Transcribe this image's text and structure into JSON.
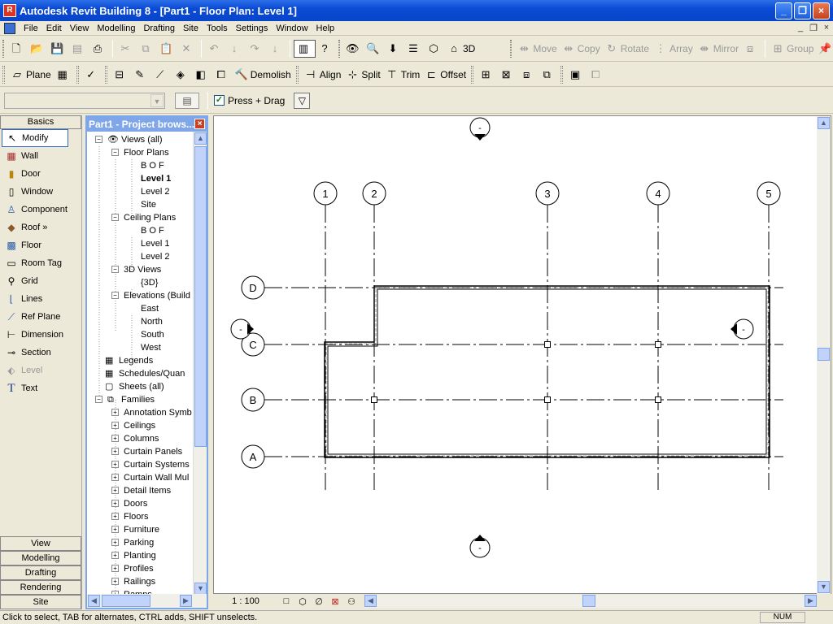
{
  "window": {
    "title": "Autodesk Revit Building 8 - [Part1 - Floor Plan: Level 1]",
    "controls": {
      "minimize": "_",
      "maximize": "❐",
      "close": "×"
    }
  },
  "menubar": {
    "items": [
      "File",
      "Edit",
      "View",
      "Modelling",
      "Drafting",
      "Site",
      "Tools",
      "Settings",
      "Window",
      "Help"
    ],
    "mdi_controls": [
      "_",
      "❐",
      "×"
    ]
  },
  "toolbar1": {
    "view_3d_label": "3D",
    "edit_tools": [
      "Move",
      "Copy",
      "Rotate",
      "Array",
      "Mirror",
      "Group"
    ]
  },
  "toolbar2": {
    "plane_label": "Plane",
    "demolish_label": "Demolish",
    "align_label": "Align",
    "split_label": "Split",
    "trim_label": "Trim",
    "offset_label": "Offset"
  },
  "options_bar": {
    "type_selector_value": "",
    "press_drag_label": "Press + Drag",
    "press_drag_checked": true
  },
  "design_bar": {
    "active_tab": "Basics",
    "tools": [
      {
        "label": "Modify",
        "icon": "cursor-icon",
        "active": true
      },
      {
        "label": "Wall",
        "icon": "wall-icon"
      },
      {
        "label": "Door",
        "icon": "door-icon"
      },
      {
        "label": "Window",
        "icon": "window-icon"
      },
      {
        "label": "Component",
        "icon": "component-icon"
      },
      {
        "label": "Roof »",
        "icon": "roof-icon"
      },
      {
        "label": "Floor",
        "icon": "floor-icon"
      },
      {
        "label": "Room Tag",
        "icon": "room-tag-icon"
      },
      {
        "label": "Grid",
        "icon": "grid-icon"
      },
      {
        "label": "Lines",
        "icon": "lines-icon"
      },
      {
        "label": "Ref Plane",
        "icon": "ref-plane-icon"
      },
      {
        "label": "Dimension",
        "icon": "dimension-icon"
      },
      {
        "label": "Section",
        "icon": "section-icon"
      },
      {
        "label": "Level",
        "icon": "level-icon",
        "disabled": true
      },
      {
        "label": "Text",
        "icon": "text-icon"
      }
    ],
    "bottom_tabs": [
      "View",
      "Modelling",
      "Drafting",
      "Rendering",
      "Site"
    ]
  },
  "project_browser": {
    "title": "Part1 - Project brows...",
    "nodes": [
      {
        "label": "Views (all)",
        "level": 0,
        "expander": "−",
        "icon": "eye"
      },
      {
        "label": "Floor Plans",
        "level": 1,
        "expander": "−"
      },
      {
        "label": "B O F",
        "level": 2
      },
      {
        "label": "Level 1",
        "level": 2,
        "bold": true
      },
      {
        "label": "Level 2",
        "level": 2
      },
      {
        "label": "Site",
        "level": 2
      },
      {
        "label": "Ceiling Plans",
        "level": 1,
        "expander": "−"
      },
      {
        "label": "B O F",
        "level": 2
      },
      {
        "label": "Level 1",
        "level": 2
      },
      {
        "label": "Level 2",
        "level": 2
      },
      {
        "label": "3D Views",
        "level": 1,
        "expander": "−"
      },
      {
        "label": "{3D}",
        "level": 2
      },
      {
        "label": "Elevations (Build",
        "level": 1,
        "expander": "−"
      },
      {
        "label": "East",
        "level": 2
      },
      {
        "label": "North",
        "level": 2
      },
      {
        "label": "South",
        "level": 2
      },
      {
        "label": "West",
        "level": 2
      },
      {
        "label": "Legends",
        "level": 0,
        "icon": "table"
      },
      {
        "label": "Schedules/Quan",
        "level": 0,
        "icon": "table"
      },
      {
        "label": "Sheets (all)",
        "level": 0,
        "icon": "sheet"
      },
      {
        "label": "Families",
        "level": 0,
        "expander": "−",
        "icon": "families"
      },
      {
        "label": "Annotation Symb",
        "level": 1,
        "expander": "+"
      },
      {
        "label": "Ceilings",
        "level": 1,
        "expander": "+"
      },
      {
        "label": "Columns",
        "level": 1,
        "expander": "+"
      },
      {
        "label": "Curtain Panels",
        "level": 1,
        "expander": "+"
      },
      {
        "label": "Curtain Systems",
        "level": 1,
        "expander": "+"
      },
      {
        "label": "Curtain Wall Mul",
        "level": 1,
        "expander": "+"
      },
      {
        "label": "Detail Items",
        "level": 1,
        "expander": "+"
      },
      {
        "label": "Doors",
        "level": 1,
        "expander": "+"
      },
      {
        "label": "Floors",
        "level": 1,
        "expander": "+"
      },
      {
        "label": "Furniture",
        "level": 1,
        "expander": "+"
      },
      {
        "label": "Parking",
        "level": 1,
        "expander": "+"
      },
      {
        "label": "Planting",
        "level": 1,
        "expander": "+"
      },
      {
        "label": "Profiles",
        "level": 1,
        "expander": "+"
      },
      {
        "label": "Railings",
        "level": 1,
        "expander": "+"
      },
      {
        "label": "Ramps",
        "level": 1,
        "expander": "+"
      }
    ]
  },
  "drawing": {
    "grid_columns": [
      "1",
      "2",
      "3",
      "4",
      "5"
    ],
    "grid_rows": [
      "D",
      "C",
      "B",
      "A"
    ],
    "elevation_marker_label": "-"
  },
  "view_control": {
    "scale": "1 : 100"
  },
  "status": {
    "message": "Click to select, TAB for alternates, CTRL adds, SHIFT unselects.",
    "num_indicator": "NUM"
  }
}
